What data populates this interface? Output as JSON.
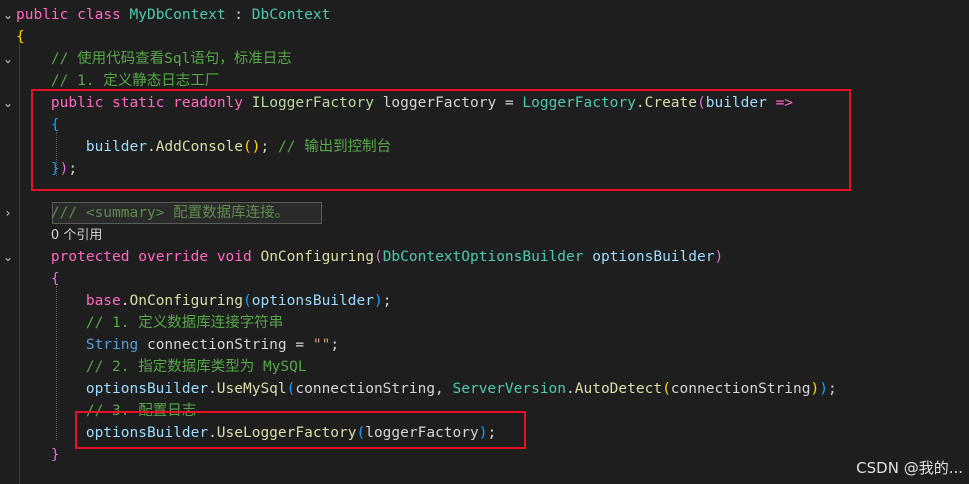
{
  "editor": {
    "lines": [
      {
        "fold": "⌄",
        "tokens": [
          [
            "kw2",
            "public"
          ],
          [
            "pl",
            " "
          ],
          [
            "kw2",
            "class"
          ],
          [
            "pl",
            " "
          ],
          [
            "typ",
            "MyDbContext"
          ],
          [
            "pl",
            " : "
          ],
          [
            "typ",
            "DbContext"
          ]
        ]
      },
      {
        "fold": "",
        "tokens": [
          [
            "br1",
            "{"
          ]
        ]
      },
      {
        "fold": "⌄",
        "tokens": [
          [
            "pl",
            "    "
          ],
          [
            "cm",
            "// 使用代码查看Sql语句，标准日志"
          ]
        ]
      },
      {
        "fold": "",
        "tokens": [
          [
            "pl",
            "    "
          ],
          [
            "cm",
            "// 1. 定义静态日志工厂"
          ]
        ]
      },
      {
        "fold": "⌄",
        "tokens": [
          [
            "pl",
            "    "
          ],
          [
            "kw2",
            "public"
          ],
          [
            "pl",
            " "
          ],
          [
            "kw2",
            "static"
          ],
          [
            "pl",
            " "
          ],
          [
            "kw2",
            "readonly"
          ],
          [
            "pl",
            " "
          ],
          [
            "iface",
            "ILoggerFactory"
          ],
          [
            "pl",
            " loggerFactory = "
          ],
          [
            "typ",
            "LoggerFactory"
          ],
          [
            "pl",
            "."
          ],
          [
            "fn",
            "Create"
          ],
          [
            "br2",
            "("
          ],
          [
            "par",
            "builder"
          ],
          [
            "pl",
            " "
          ],
          [
            "kw2",
            "=>"
          ]
        ]
      },
      {
        "fold": "",
        "tokens": [
          [
            "pl",
            "    "
          ],
          [
            "br3",
            "{"
          ]
        ]
      },
      {
        "fold": "",
        "tokens": [
          [
            "pl",
            "        "
          ],
          [
            "par",
            "builder"
          ],
          [
            "pl",
            "."
          ],
          [
            "fn",
            "AddConsole"
          ],
          [
            "br1",
            "()"
          ],
          [
            "pl",
            "; "
          ],
          [
            "cm",
            "// 输出到控制台"
          ]
        ]
      },
      {
        "fold": "",
        "tokens": [
          [
            "pl",
            "    "
          ],
          [
            "br3",
            "}"
          ],
          [
            "br2",
            ")"
          ],
          [
            "pl",
            ";"
          ]
        ]
      },
      {
        "fold": "",
        "tokens": []
      },
      {
        "fold": "›",
        "tokens": [
          [
            "pl",
            "    "
          ],
          [
            "doc",
            "/// <summary> 配置数据库连接。"
          ]
        ]
      },
      {
        "fold": "",
        "tokens": [
          [
            "pl",
            "    "
          ],
          [
            "codelens",
            "0 个引用"
          ]
        ]
      },
      {
        "fold": "⌄",
        "tokens": [
          [
            "pl",
            "    "
          ],
          [
            "kw2",
            "protected"
          ],
          [
            "pl",
            " "
          ],
          [
            "kw2",
            "override"
          ],
          [
            "pl",
            " "
          ],
          [
            "kw2",
            "void"
          ],
          [
            "pl",
            " "
          ],
          [
            "fn",
            "OnConfiguring"
          ],
          [
            "br2",
            "("
          ],
          [
            "typ",
            "DbContextOptionsBuilder"
          ],
          [
            "pl",
            " "
          ],
          [
            "par",
            "optionsBuilder"
          ],
          [
            "br2",
            ")"
          ]
        ]
      },
      {
        "fold": "",
        "tokens": [
          [
            "pl",
            "    "
          ],
          [
            "br2",
            "{"
          ]
        ]
      },
      {
        "fold": "",
        "tokens": [
          [
            "pl",
            "        "
          ],
          [
            "kw2",
            "base"
          ],
          [
            "pl",
            "."
          ],
          [
            "fn",
            "OnConfiguring"
          ],
          [
            "br3",
            "("
          ],
          [
            "par",
            "optionsBuilder"
          ],
          [
            "br3",
            ")"
          ],
          [
            "pl",
            ";"
          ]
        ]
      },
      {
        "fold": "",
        "tokens": [
          [
            "pl",
            "        "
          ],
          [
            "cm",
            "// 1. 定义数据库连接字符串"
          ]
        ]
      },
      {
        "fold": "",
        "tokens": [
          [
            "pl",
            "        "
          ],
          [
            "kw",
            "String"
          ],
          [
            "pl",
            " connectionString = "
          ],
          [
            "str",
            "\"\""
          ],
          [
            "pl",
            ";"
          ]
        ]
      },
      {
        "fold": "",
        "tokens": [
          [
            "pl",
            "        "
          ],
          [
            "cm",
            "// 2. 指定数据库类型为 MySQL"
          ]
        ]
      },
      {
        "fold": "",
        "tokens": [
          [
            "pl",
            "        "
          ],
          [
            "par",
            "optionsBuilder"
          ],
          [
            "pl",
            "."
          ],
          [
            "fn",
            "UseMySql"
          ],
          [
            "br3",
            "("
          ],
          [
            "pl",
            "connectionString, "
          ],
          [
            "typ",
            "ServerVersion"
          ],
          [
            "pl",
            "."
          ],
          [
            "fn",
            "AutoDetect"
          ],
          [
            "br1",
            "("
          ],
          [
            "pl",
            "connectionString"
          ],
          [
            "br1",
            ")"
          ],
          [
            "br3",
            ")"
          ],
          [
            "pl",
            ";"
          ]
        ]
      },
      {
        "fold": "",
        "tokens": [
          [
            "pl",
            "        "
          ],
          [
            "cm",
            "// 3. 配置日志"
          ]
        ]
      },
      {
        "fold": "",
        "tokens": [
          [
            "pl",
            "        "
          ],
          [
            "par",
            "optionsBuilder"
          ],
          [
            "pl",
            "."
          ],
          [
            "fn",
            "UseLoggerFactory"
          ],
          [
            "br3",
            "("
          ],
          [
            "pl",
            "loggerFactory"
          ],
          [
            "br3",
            ")"
          ],
          [
            "pl",
            ";"
          ]
        ]
      },
      {
        "fold": "",
        "tokens": [
          [
            "pl",
            "    "
          ],
          [
            "br2",
            "}"
          ]
        ]
      }
    ]
  },
  "watermark": "CSDN @我的..."
}
